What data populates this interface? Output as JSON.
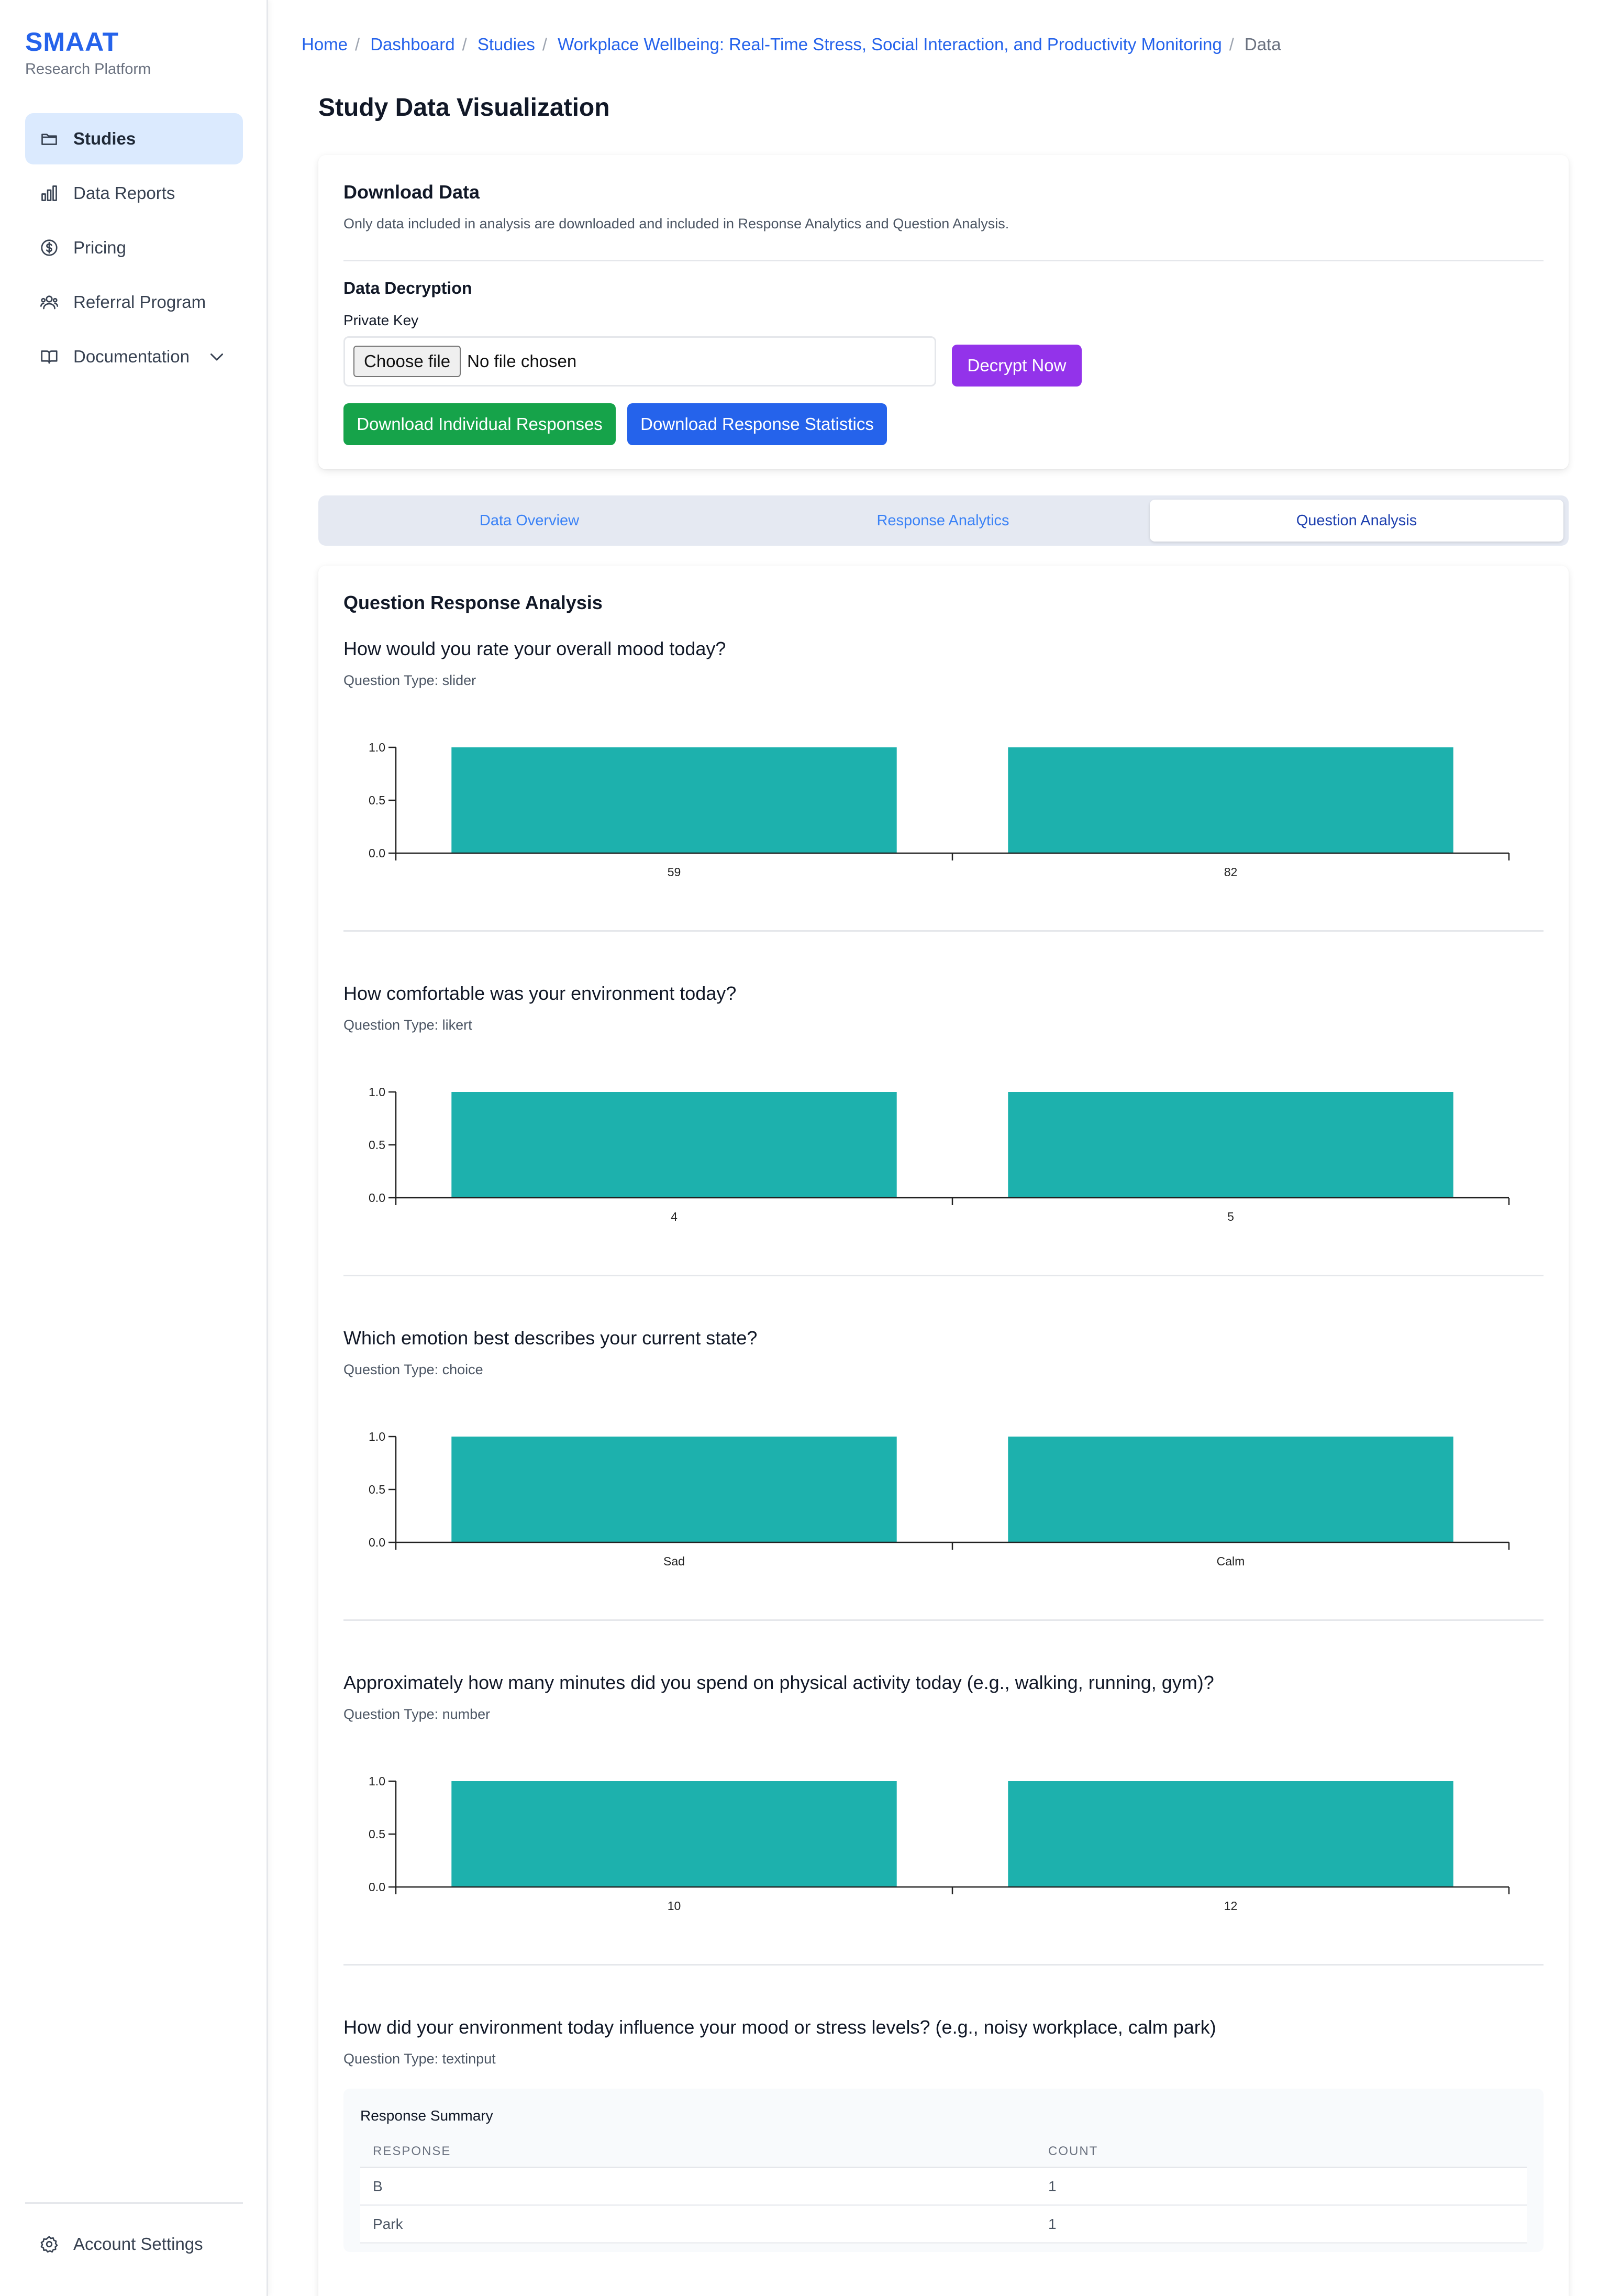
{
  "brand": {
    "name": "SMAAT",
    "subtitle": "Research Platform"
  },
  "sidebar": {
    "items": [
      {
        "label": "Studies",
        "icon": "folder-icon",
        "active": true
      },
      {
        "label": "Data Reports",
        "icon": "bar-chart-icon"
      },
      {
        "label": "Pricing",
        "icon": "dollar-circle-icon"
      },
      {
        "label": "Referral Program",
        "icon": "users-icon"
      },
      {
        "label": "Documentation",
        "icon": "book-icon",
        "expandable": true
      }
    ],
    "account_settings": "Account Settings"
  },
  "breadcrumb": [
    "Home",
    "Dashboard",
    "Studies",
    "Workplace Wellbeing: Real-Time Stress, Social Interaction, and Productivity Monitoring",
    "Data"
  ],
  "page_title": "Study Data Visualization",
  "download": {
    "title": "Download Data",
    "description": "Only data included in analysis are downloaded and included in Response Analytics and Question Analysis.",
    "decryption_title": "Data Decryption",
    "private_key_label": "Private Key",
    "choose_file": "Choose file",
    "file_status": "No file chosen",
    "decrypt_button": "Decrypt Now",
    "download_individual": "Download Individual Responses",
    "download_statistics": "Download Response Statistics"
  },
  "tabs": [
    {
      "label": "Data Overview"
    },
    {
      "label": "Response Analytics"
    },
    {
      "label": "Question Analysis",
      "active": true
    }
  ],
  "analysis": {
    "heading": "Question Response Analysis",
    "questions": [
      {
        "title": "How would you rate your overall mood today?",
        "type": "Question Type: slider"
      },
      {
        "title": "How comfortable was your environment today?",
        "type": "Question Type: likert"
      },
      {
        "title": "Which emotion best describes your current state?",
        "type": "Question Type: choice"
      },
      {
        "title": "Approximately how many minutes did you spend on physical activity today (e.g., walking, running, gym)?",
        "type": "Question Type: number"
      },
      {
        "title": "How did your environment today influence your mood or stress levels? (e.g., noisy workplace, calm park)",
        "type": "Question Type: textinput"
      }
    ],
    "summary": {
      "title": "Response Summary",
      "headers": [
        "RESPONSE",
        "COUNT"
      ],
      "rows": [
        [
          "B",
          "1"
        ],
        [
          "Park",
          "1"
        ]
      ]
    }
  },
  "colors": {
    "accent": "#2563eb",
    "bar": "#1db1ad",
    "decrypt": "#9333ea",
    "download_green": "#16a34a"
  },
  "chart_data": [
    {
      "type": "bar",
      "categories": [
        "59",
        "82"
      ],
      "values": [
        1,
        1
      ],
      "ylim": [
        0,
        1
      ],
      "yticks": [
        "0.0",
        "0.5",
        "1.0"
      ]
    },
    {
      "type": "bar",
      "categories": [
        "4",
        "5"
      ],
      "values": [
        1,
        1
      ],
      "ylim": [
        0,
        1
      ],
      "yticks": [
        "0.0",
        "0.5",
        "1.0"
      ]
    },
    {
      "type": "bar",
      "categories": [
        "Sad",
        "Calm"
      ],
      "values": [
        1,
        1
      ],
      "ylim": [
        0,
        1
      ],
      "yticks": [
        "0.0",
        "0.5",
        "1.0"
      ]
    },
    {
      "type": "bar",
      "categories": [
        "10",
        "12"
      ],
      "values": [
        1,
        1
      ],
      "ylim": [
        0,
        1
      ],
      "yticks": [
        "0.0",
        "0.5",
        "1.0"
      ]
    }
  ]
}
